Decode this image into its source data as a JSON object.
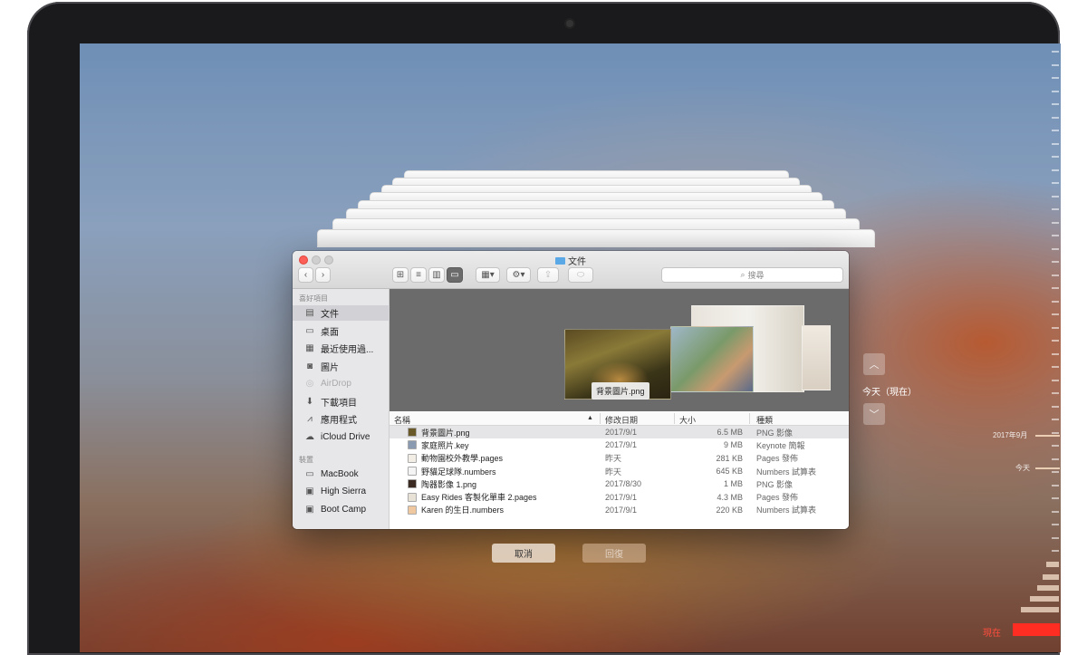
{
  "window": {
    "title": "文件",
    "search_placeholder": "搜尋"
  },
  "sidebar": {
    "favorites_header": "喜好項目",
    "favorites": [
      {
        "label": "文件",
        "icon": "document-icon",
        "selected": true
      },
      {
        "label": "桌面",
        "icon": "desktop-icon"
      },
      {
        "label": "最近使用過...",
        "icon": "recents-icon"
      },
      {
        "label": "圖片",
        "icon": "camera-icon"
      },
      {
        "label": "AirDrop",
        "icon": "airdrop-icon",
        "dimmed": true
      },
      {
        "label": "下載項目",
        "icon": "download-icon"
      },
      {
        "label": "應用程式",
        "icon": "applications-icon"
      },
      {
        "label": "iCloud Drive",
        "icon": "cloud-icon"
      }
    ],
    "devices_header": "裝置",
    "devices": [
      {
        "label": "MacBook",
        "icon": "laptop-icon"
      },
      {
        "label": "High Sierra",
        "icon": "disk-icon"
      },
      {
        "label": "Boot Camp",
        "icon": "disk-icon"
      }
    ]
  },
  "coverflow": {
    "selected_label": "背景圖片.png"
  },
  "list": {
    "columns": [
      "名稱",
      "修改日期",
      "大小",
      "種類"
    ],
    "rows": [
      {
        "name": "背景圖片.png",
        "date": "2017/9/1",
        "size": "6.5 MB",
        "kind": "PNG 影像",
        "selected": true
      },
      {
        "name": "家庭照片.key",
        "date": "2017/9/1",
        "size": "9 MB",
        "kind": "Keynote 簡報"
      },
      {
        "name": "動物園校外教學.pages",
        "date": "昨天",
        "size": "281 KB",
        "kind": "Pages 發佈"
      },
      {
        "name": "野貓足球隊.numbers",
        "date": "昨天",
        "size": "645 KB",
        "kind": "Numbers 試算表"
      },
      {
        "name": "陶器影像 1.png",
        "date": "2017/8/30",
        "size": "1 MB",
        "kind": "PNG 影像"
      },
      {
        "name": "Easy Rides 客製化單車 2.pages",
        "date": "2017/9/1",
        "size": "4.3 MB",
        "kind": "Pages 發佈"
      },
      {
        "name": "Karen 的生日.numbers",
        "date": "2017/9/1",
        "size": "220 KB",
        "kind": "Numbers 試算表"
      }
    ]
  },
  "buttons": {
    "cancel": "取消",
    "restore": "回復"
  },
  "navigation": {
    "current_label": "今天（現在）"
  },
  "timeline": {
    "label_month": "2017年9月",
    "label_today": "今天",
    "label_now": "現在"
  },
  "colors": {
    "accent_red": "#ff2d22",
    "window_bg": "#ffffff",
    "sidebar_bg": "#e7e7ea"
  }
}
